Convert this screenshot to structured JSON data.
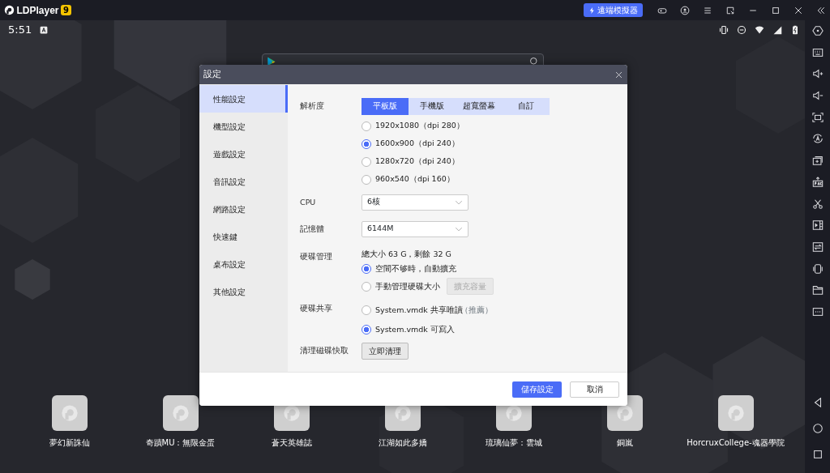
{
  "app": {
    "name": "LDPlayer",
    "version": "9"
  },
  "title_bar": {
    "remote_button": "遠端模擬器"
  },
  "status_bar": {
    "time": "5:51"
  },
  "dialog": {
    "title": "設定",
    "nav": [
      {
        "label": "性能設定",
        "selected": true
      },
      {
        "label": "機型設定",
        "selected": false
      },
      {
        "label": "遊戲設定",
        "selected": false
      },
      {
        "label": "音訊設定",
        "selected": false
      },
      {
        "label": "網路設定",
        "selected": false
      },
      {
        "label": "快速鍵",
        "selected": false
      },
      {
        "label": "桌布設定",
        "selected": false
      },
      {
        "label": "其他設定",
        "selected": false
      }
    ],
    "resolution": {
      "label": "解析度",
      "tabs": [
        {
          "label": "平板版",
          "selected": true
        },
        {
          "label": "手機版",
          "selected": false
        },
        {
          "label": "超寬螢幕",
          "selected": false
        },
        {
          "label": "自訂",
          "selected": false
        }
      ],
      "options": [
        {
          "label": "1920x1080（dpi 280）",
          "selected": false
        },
        {
          "label": "1600x900（dpi 240）",
          "selected": true
        },
        {
          "label": "1280x720（dpi 240）",
          "selected": false
        },
        {
          "label": "960x540（dpi 160）",
          "selected": false
        }
      ]
    },
    "cpu": {
      "label": "CPU",
      "value": "6核"
    },
    "memory": {
      "label": "記憶體",
      "value": "6144M"
    },
    "disk": {
      "label": "硬碟管理",
      "summary": "總大小 63 G，剩餘 32 G",
      "options": [
        {
          "label": "空間不够時，自動擴充",
          "selected": true
        },
        {
          "label": "手動管理硬碟大小",
          "selected": false
        }
      ],
      "expand_button": {
        "label": "擴充容量",
        "disabled": true
      }
    },
    "share": {
      "label": "硬碟共享",
      "options": [
        {
          "label": "System.vmdk 共享唯讀",
          "note": "（推薦）",
          "selected": false
        },
        {
          "label": "System.vmdk 可寫入",
          "selected": true
        }
      ]
    },
    "cache": {
      "label": "清理磁碟快取",
      "button": "立即清理"
    },
    "save_button": "儲存設定",
    "cancel_button": "取消"
  },
  "apps": [
    {
      "name": "夢幻新誅仙"
    },
    {
      "name": "奇蹟MU：無限金蛋"
    },
    {
      "name": "蒼天英雄誌"
    },
    {
      "name": "江湖如此多嬌"
    },
    {
      "name": "琉璃仙夢：雲城"
    },
    {
      "name": "銅嵐"
    },
    {
      "name": "HorcruxCollege-魂器學院"
    }
  ]
}
